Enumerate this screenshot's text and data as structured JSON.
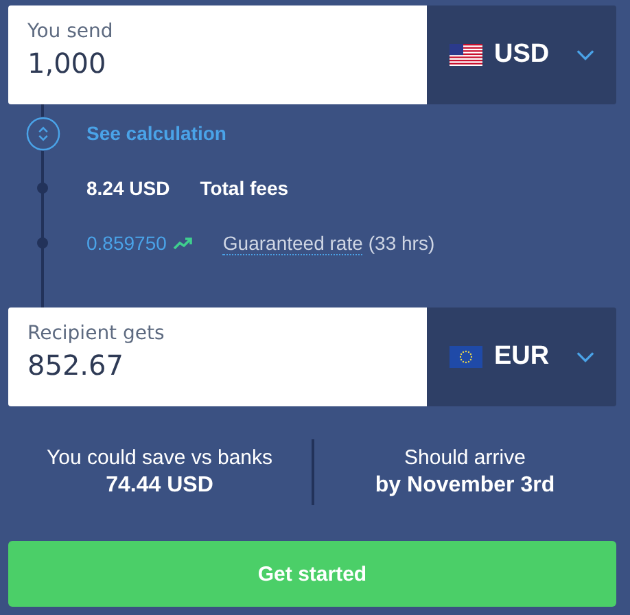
{
  "send": {
    "label": "You send",
    "value": "1,000",
    "currency": "USD",
    "kind": "us"
  },
  "calculation": {
    "link": "See calculation",
    "expanded": false,
    "fees": {
      "amount": "8.24 USD",
      "label": "Total fees"
    },
    "rate": {
      "value": "0.859750",
      "label": "Guaranteed rate",
      "note": "(33 hrs)"
    }
  },
  "receive": {
    "label": "Recipient gets",
    "value": "852.67",
    "currency": "EUR",
    "kind": "eu"
  },
  "stats": [
    {
      "label": "You could save vs banks",
      "value": "74.44 USD"
    },
    {
      "label": "Should arrive",
      "value": "by November 3rd"
    }
  ],
  "button": "Get started"
}
